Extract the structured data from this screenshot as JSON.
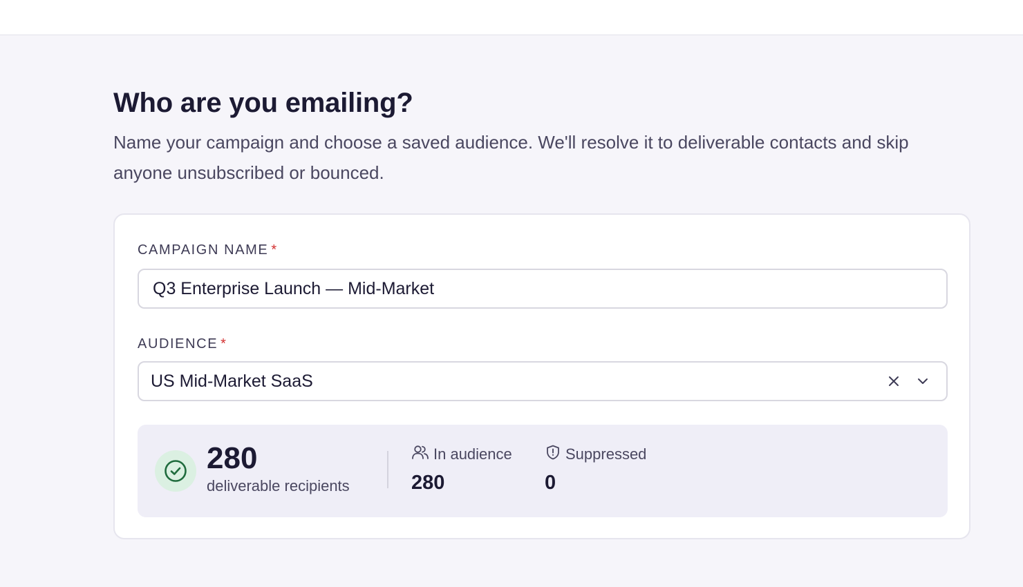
{
  "page": {
    "title": "Who are you emailing?",
    "description": "Name your campaign and choose a saved audience. We'll resolve it to deliverable contacts and skip anyone unsubscribed or bounced."
  },
  "campaign_name": {
    "label": "CAMPAIGN NAME",
    "required_marker": "*",
    "value": "Q3 Enterprise Launch — Mid-Market"
  },
  "audience": {
    "label": "AUDIENCE",
    "required_marker": "*",
    "selected": "US Mid-Market SaaS",
    "clear_icon": "close-icon",
    "dropdown_icon": "chevron-down-icon"
  },
  "summary": {
    "deliverable_count": "280",
    "deliverable_label": "deliverable recipients",
    "in_audience_label": "In audience",
    "in_audience_value": "280",
    "suppressed_label": "Suppressed",
    "suppressed_value": "0",
    "status_icon": "check-circle-icon"
  },
  "colors": {
    "accent_success": "#1f6b3d",
    "success_bg": "#dbf0e2",
    "required": "#d33131",
    "page_bg": "#f6f5fa"
  }
}
